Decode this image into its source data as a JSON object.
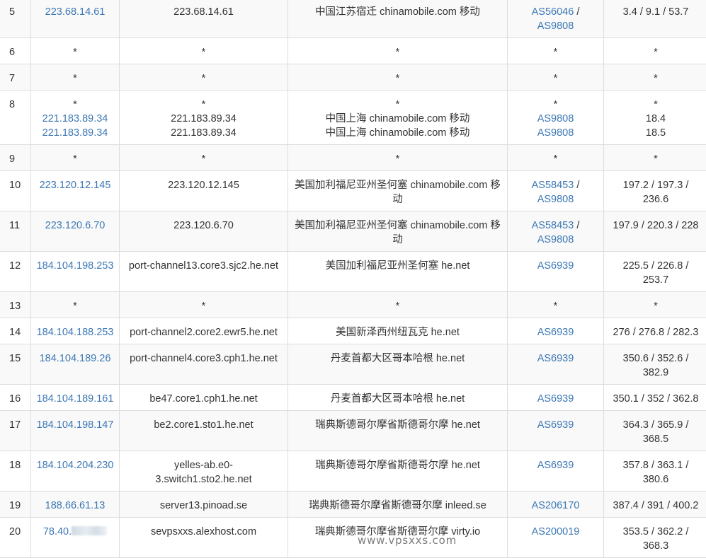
{
  "rows": [
    {
      "hop": "5",
      "ip": [
        "223.68.14.61"
      ],
      "host": [
        "223.68.14.61"
      ],
      "loc": [
        "中国江苏宿迁 chinamobile.com 移动"
      ],
      "as": [
        [
          "AS56046",
          " /"
        ],
        [
          "AS9808",
          ""
        ]
      ],
      "lat": [
        "3.4 / 9.1 / 53.7"
      ]
    },
    {
      "hop": "6",
      "ip": [
        "*"
      ],
      "host": [
        "*"
      ],
      "loc": [
        "*"
      ],
      "as": [
        [
          "*",
          ""
        ]
      ],
      "lat": [
        "*"
      ]
    },
    {
      "hop": "7",
      "ip": [
        "*"
      ],
      "host": [
        "*"
      ],
      "loc": [
        "*"
      ],
      "as": [
        [
          "*",
          ""
        ]
      ],
      "lat": [
        "*"
      ]
    },
    {
      "hop": "8",
      "ip": [
        "*",
        "221.183.89.34",
        "221.183.89.34"
      ],
      "host": [
        "*",
        "221.183.89.34",
        "221.183.89.34"
      ],
      "loc": [
        "*",
        "中国上海 chinamobile.com 移动",
        "中国上海 chinamobile.com 移动"
      ],
      "as": [
        [
          "*",
          ""
        ],
        [
          "AS9808",
          ""
        ],
        [
          "AS9808",
          ""
        ]
      ],
      "lat": [
        "*",
        "18.4",
        "18.5"
      ]
    },
    {
      "hop": "9",
      "ip": [
        "*"
      ],
      "host": [
        "*"
      ],
      "loc": [
        "*"
      ],
      "as": [
        [
          "*",
          ""
        ]
      ],
      "lat": [
        "*"
      ]
    },
    {
      "hop": "10",
      "ip": [
        "223.120.12.145"
      ],
      "host": [
        "223.120.12.145"
      ],
      "loc": [
        "美国加利福尼亚州圣何塞 chinamobile.com 移",
        "动"
      ],
      "as": [
        [
          "AS58453",
          " /"
        ],
        [
          "AS9808",
          ""
        ]
      ],
      "lat": [
        "197.2 / 197.3 /",
        "236.6"
      ]
    },
    {
      "hop": "11",
      "ip": [
        "223.120.6.70"
      ],
      "host": [
        "223.120.6.70"
      ],
      "loc": [
        "美国加利福尼亚州圣何塞 chinamobile.com 移",
        "动"
      ],
      "as": [
        [
          "AS58453",
          " /"
        ],
        [
          "AS9808",
          ""
        ]
      ],
      "lat": [
        "197.9 / 220.3 / 228"
      ]
    },
    {
      "hop": "12",
      "ip": [
        "184.104.198.253"
      ],
      "host": [
        "port-channel13.core3.sjc2.he.net"
      ],
      "loc": [
        "美国加利福尼亚州圣何塞 he.net"
      ],
      "as": [
        [
          "AS6939",
          ""
        ]
      ],
      "lat": [
        "225.5 / 226.8 /",
        "253.7"
      ]
    },
    {
      "hop": "13",
      "ip": [
        "*"
      ],
      "host": [
        "*"
      ],
      "loc": [
        "*"
      ],
      "as": [
        [
          "*",
          ""
        ]
      ],
      "lat": [
        "*"
      ]
    },
    {
      "hop": "14",
      "ip": [
        "184.104.188.253"
      ],
      "host": [
        "port-channel2.core2.ewr5.he.net"
      ],
      "loc": [
        "美国新泽西州纽瓦克 he.net"
      ],
      "as": [
        [
          "AS6939",
          ""
        ]
      ],
      "lat": [
        "276 / 276.8 / 282.3"
      ]
    },
    {
      "hop": "15",
      "ip": [
        "184.104.189.26"
      ],
      "host": [
        "port-channel4.core3.cph1.he.net"
      ],
      "loc": [
        "丹麦首都大区哥本哈根 he.net"
      ],
      "as": [
        [
          "AS6939",
          ""
        ]
      ],
      "lat": [
        "350.6 / 352.6 /",
        "382.9"
      ]
    },
    {
      "hop": "16",
      "ip": [
        "184.104.189.161"
      ],
      "host": [
        "be47.core1.cph1.he.net"
      ],
      "loc": [
        "丹麦首都大区哥本哈根 he.net"
      ],
      "as": [
        [
          "AS6939",
          ""
        ]
      ],
      "lat": [
        "350.1 / 352 / 362.8"
      ]
    },
    {
      "hop": "17",
      "ip": [
        "184.104.198.147"
      ],
      "host": [
        "be2.core1.sto1.he.net"
      ],
      "loc": [
        "瑞典斯德哥尔摩省斯德哥尔摩 he.net"
      ],
      "as": [
        [
          "AS6939",
          ""
        ]
      ],
      "lat": [
        "364.3 / 365.9 /",
        "368.5"
      ]
    },
    {
      "hop": "18",
      "ip": [
        "184.104.204.230"
      ],
      "host": [
        "yelles-ab.e0-",
        "3.switch1.sto2.he.net"
      ],
      "loc": [
        "瑞典斯德哥尔摩省斯德哥尔摩 he.net"
      ],
      "as": [
        [
          "AS6939",
          ""
        ]
      ],
      "lat": [
        "357.8 / 363.1 /",
        "380.6"
      ]
    },
    {
      "hop": "19",
      "ip": [
        "188.66.61.13"
      ],
      "host": [
        "server13.pinoad.se"
      ],
      "loc": [
        "瑞典斯德哥尔摩省斯德哥尔摩 inleed.se"
      ],
      "as": [
        [
          "AS206170",
          ""
        ]
      ],
      "lat": [
        "387.4 / 391 / 400.2"
      ]
    },
    {
      "hop": "20",
      "ip": [
        "78.40."
      ],
      "ip_blurred": true,
      "host": [
        "sevpsxxs.alexhost.com"
      ],
      "loc": [
        "瑞典斯德哥尔摩省斯德哥尔摩 virty.io"
      ],
      "as": [
        [
          "AS200019",
          ""
        ]
      ],
      "lat": [
        "353.5 / 362.2 /",
        "368.3"
      ]
    }
  ],
  "watermark": "www.vpsxxs.com",
  "colors": {
    "link": "#3c78b4",
    "text": "#333333",
    "border": "#dddddd",
    "stripe": "#f9f9f9"
  }
}
